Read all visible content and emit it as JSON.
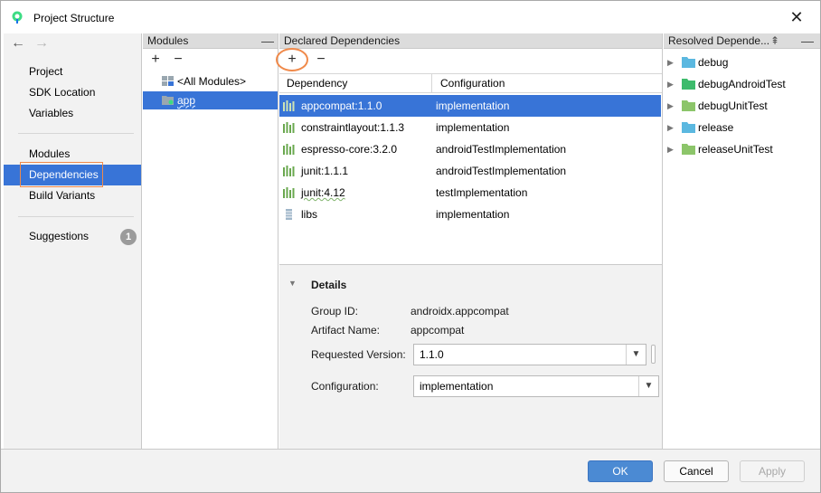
{
  "window": {
    "title": "Project Structure"
  },
  "nav": {
    "back_icon": "arrow-left-icon",
    "forward_icon": "arrow-right-icon",
    "items": [
      {
        "label": "Project"
      },
      {
        "label": "SDK Location"
      },
      {
        "label": "Variables"
      },
      {
        "label": "Modules"
      },
      {
        "label": "Dependencies"
      },
      {
        "label": "Build Variants"
      },
      {
        "label": "Suggestions",
        "badge": "1"
      }
    ]
  },
  "modules": {
    "header": "Modules",
    "items": [
      {
        "label": "<All Modules>"
      },
      {
        "label": "app"
      }
    ]
  },
  "declared": {
    "header": "Declared Dependencies",
    "columns": {
      "dependency": "Dependency",
      "configuration": "Configuration"
    },
    "rows": [
      {
        "name": "appcompat:1.1.0",
        "conf": "implementation"
      },
      {
        "name": "constraintlayout:1.1.3",
        "conf": "implementation"
      },
      {
        "name": "espresso-core:3.2.0",
        "conf": "androidTestImplementation"
      },
      {
        "name": "junit:1.1.1",
        "conf": "androidTestImplementation"
      },
      {
        "name": "junit:4.12",
        "conf": "testImplementation"
      },
      {
        "name": "libs",
        "conf": "implementation"
      }
    ]
  },
  "details": {
    "title": "Details",
    "group_id_label": "Group ID:",
    "group_id": "androidx.appcompat",
    "artifact_label": "Artifact Name:",
    "artifact": "appcompat",
    "version_label": "Requested Version:",
    "version": "1.1.0",
    "configuration_label": "Configuration:",
    "configuration": "implementation"
  },
  "resolved": {
    "header": "Resolved Depende...",
    "items": [
      {
        "label": "debug",
        "color": "#5bb8e0"
      },
      {
        "label": "debugAndroidTest",
        "color": "#3dbb6c"
      },
      {
        "label": "debugUnitTest",
        "color": "#8cc56a"
      },
      {
        "label": "release",
        "color": "#5bb8e0"
      },
      {
        "label": "releaseUnitTest",
        "color": "#8cc56a"
      }
    ]
  },
  "footer": {
    "ok": "OK",
    "cancel": "Cancel",
    "apply": "Apply"
  },
  "colors": {
    "selection": "#3874d7",
    "highlight": "#f08a4b"
  }
}
